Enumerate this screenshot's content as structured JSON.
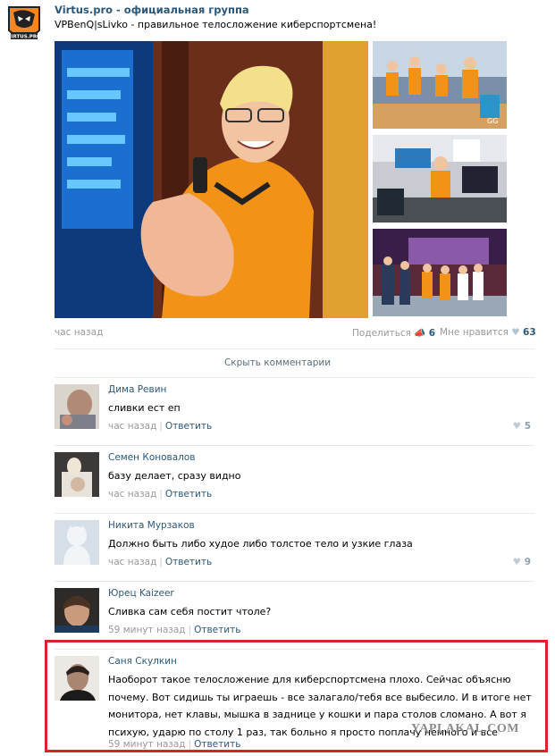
{
  "group": {
    "name": "Virtus.pro - официальная группа",
    "logo_icon": "virtus-pro-bear-logo-icon",
    "logo_text": "VIRTUS.PRO"
  },
  "post": {
    "text": "VPBenQ|sLivko - правильное телосложение киберспортсмена!",
    "time": "час назад",
    "share_label": "Поделиться",
    "share_count": "6",
    "like_label": "Мне нравится",
    "like_count": "63"
  },
  "comments_toggle": "Скрыть комментарии",
  "comments": [
    {
      "author": "Дима Ревин",
      "text": "сливки ест еп",
      "time": "час назад",
      "reply": "Ответить",
      "likes": "5"
    },
    {
      "author": "Семен Коновалов",
      "text": "базу делает, сразу видно",
      "time": "час назад",
      "reply": "Ответить",
      "likes": ""
    },
    {
      "author": "Никита Мурзаков",
      "text": "Должно быть либо худое либо толстое тело и узкие глаза",
      "time": "час назад",
      "reply": "Ответить",
      "likes": "9"
    },
    {
      "author": "Юрец Kaizeer",
      "text": "Сливка сам себя постит чтоле?",
      "time": "59 минут назад",
      "reply": "Ответить",
      "likes": ""
    },
    {
      "author": "Саня Скулкин",
      "text": "Наоборот такое телосложение для киберспортсмена плохо. Сейчас объясню почему. Вот сидишь ты играешь - все залагало/тебя все выбесило. И в итоге нет монитора, нет клавы, мышка в заднице у кошки и пара столов сломано. А вот я психую, ударю по столу 1 раз, так больно я просто поплачу немного и все",
      "time": "59 минут назад",
      "reply": "Ответить",
      "likes": ""
    }
  ],
  "watermark": "YAPLAKAL.COM"
}
